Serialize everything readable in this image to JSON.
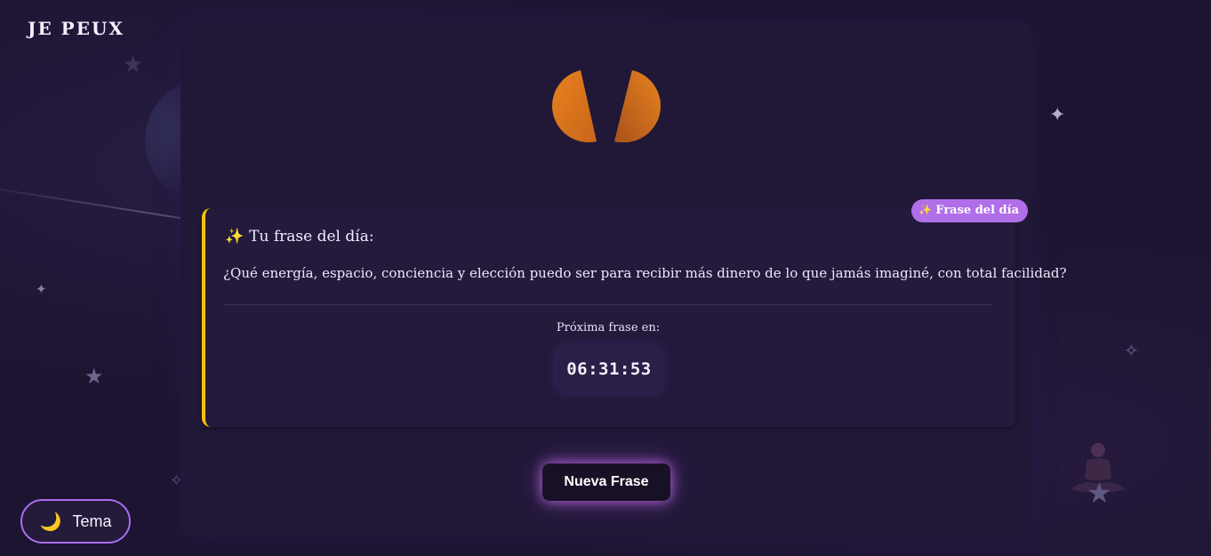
{
  "brand": {
    "name": "JE PEUX"
  },
  "quote_card": {
    "badge_icon": "sparkles-icon",
    "badge_label": "Frase del día",
    "title_icon": "sparkles-icon",
    "title": "Tu frase del día:",
    "quote": "¿Qué energía, espacio, conciencia y elección puedo ser para recibir más dinero de lo que jamás imaginé, con total facilidad?",
    "next_label": "Próxima frase en:",
    "timer": "06:31:53"
  },
  "actions": {
    "new_quote_label": "Nueva Frase",
    "theme_label": "Tema",
    "theme_icon": "moon-icon"
  },
  "colors": {
    "background": "#1c1430",
    "card": "#211838",
    "accent_border": "#f2c200",
    "badge": "#b06ee8",
    "button_glow": "#c86ef0",
    "logo_orange": "#e07a1f"
  }
}
